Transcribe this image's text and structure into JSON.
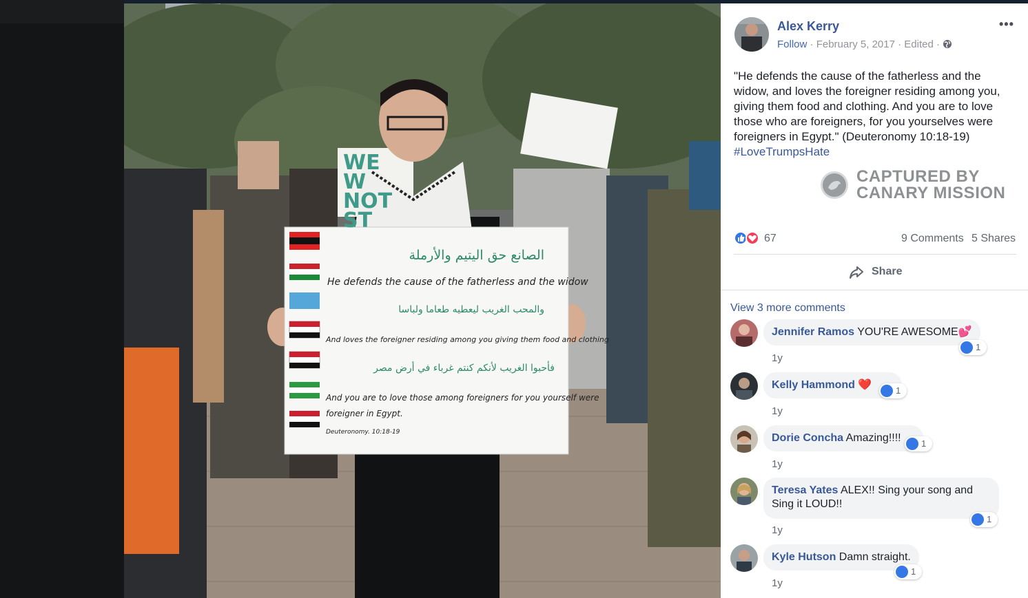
{
  "post": {
    "author": "Alex Kerry",
    "follow": "Follow",
    "date": "February 5, 2017",
    "edited": "Edited",
    "separator": "·",
    "more": "•••",
    "text": "\"He defends the cause of the fatherless and the widow, and loves the foreigner residing among you, giving them food and clothing. And you are to love those who are foreigners, for you yourselves were foreigners in Egypt.\" (Deuteronomy 10:18-19)",
    "hashtag": "#LoveTrumpsHate",
    "watermark_line1": "CAPTURED BY",
    "watermark_line2": "CANARY MISSION",
    "reaction_count": "67",
    "comments_count": "9 Comments",
    "shares_count": "5 Shares",
    "share_label": "Share",
    "view_more": "View 3 more comments"
  },
  "photo": {
    "sign": {
      "line1": "He defends the cause of the fatherless and the widow",
      "line2": "And loves the foreigner residing among you giving them food and clothing",
      "line3": "And you are to love those among foreigners for you yourself were",
      "line4": "foreigner in Egypt.",
      "line5": "Deuteronomy. 10:18-19",
      "arabic1": "الصانع حق اليتيم والأرملة",
      "arabic2": "والمحب الغريب ليعطيه طعاما ولباسا",
      "arabic3": "فأحبوا الغريب لأنكم كنتم غرباء في أرض مصر"
    },
    "protest_sign_text": "WE W NOT ST"
  },
  "comments": [
    {
      "name": "Jennifer Ramos",
      "text": "YOU'RE AWESOME💕",
      "time": "1y",
      "reactions": "1"
    },
    {
      "name": "Kelly Hammond",
      "text": "❤️",
      "time": "1y",
      "reactions": "1"
    },
    {
      "name": "Dorie Concha",
      "text": "Amazing!!!!",
      "time": "1y",
      "reactions": "1"
    },
    {
      "name": "Teresa Yates",
      "text": "ALEX!! Sing your song and Sing it LOUD!!",
      "time": "1y",
      "reactions": "1"
    },
    {
      "name": "Kyle Hutson",
      "text": "Damn straight.",
      "time": "1y",
      "reactions": "1"
    }
  ],
  "colors": {
    "link": "#385898",
    "like": "#3578e5",
    "love": "#f33e58"
  }
}
